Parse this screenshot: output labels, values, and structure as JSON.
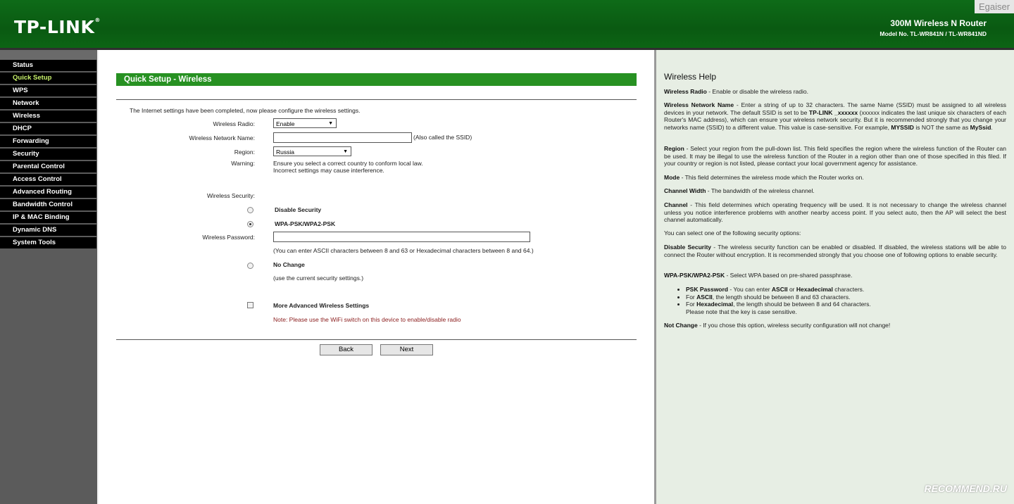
{
  "header": {
    "logo": "TP-LINK",
    "logo_mark": "®",
    "product": "300M Wireless N Router",
    "model": "Model No. TL-WR841N / TL-WR841ND",
    "watermark_top": "Egaiser"
  },
  "sidebar": {
    "items": [
      {
        "label": "Status"
      },
      {
        "label": "Quick Setup"
      },
      {
        "label": "WPS"
      },
      {
        "label": "Network"
      },
      {
        "label": "Wireless"
      },
      {
        "label": "DHCP"
      },
      {
        "label": "Forwarding"
      },
      {
        "label": "Security"
      },
      {
        "label": "Parental Control"
      },
      {
        "label": "Access Control"
      },
      {
        "label": "Advanced Routing"
      },
      {
        "label": "Bandwidth Control"
      },
      {
        "label": "IP & MAC Binding"
      },
      {
        "label": "Dynamic DNS"
      },
      {
        "label": "System Tools"
      }
    ],
    "active": "Quick Setup"
  },
  "main": {
    "title": "Quick Setup - Wireless",
    "intro": "The Internet settings have been completed, now please configure the wireless settings.",
    "radio_label": "Wireless Radio:",
    "radio_value": "Enable",
    "ssid_label": "Wireless Network Name:",
    "ssid_value": "",
    "ssid_hint": "(Also called the SSID)",
    "region_label": "Region:",
    "region_value": "Russia",
    "warning_label": "Warning:",
    "warning_line1": "Ensure you select a correct country to conform local law.",
    "warning_line2": "Incorrect settings may cause interference.",
    "security_label": "Wireless Security:",
    "opt_disable": "Disable Security",
    "opt_wpa": "WPA-PSK/WPA2-PSK",
    "password_label": "Wireless Password:",
    "password_value": "",
    "password_hint": "(You can enter ASCII characters between 8 and 63 or Hexadecimal characters between 8 and 64.)",
    "opt_nochange": "No Change",
    "nochange_hint": "(use the current security settings.)",
    "advanced_label": "More Advanced Wireless Settings",
    "note": "Note: Please use the WiFi switch on this device to enable/disable radio",
    "back_label": "Back",
    "next_label": "Next"
  },
  "help": {
    "title": "Wireless Help",
    "radio_term": "Wireless Radio",
    "radio_text": " - Enable or disable the wireless radio.",
    "name_term": "Wireless Network Name",
    "name_text1": " - Enter a string of up to 32 characters. The same Name (SSID) must be assigned to all wireless devices in your network. The default SSID is set to be ",
    "name_default": "TP-LINK _xxxxxx",
    "name_text2": " (xxxxxx indicates the last unique six characters of each Router's MAC address), which can ensure your wireless network security. But it is recommended strongly that you change your networks name (SSID) to a different value. This value is case-sensitive. For example, ",
    "name_ex1": "MYSSID",
    "name_text3": " is NOT the same as ",
    "name_ex2": "MySsid",
    "name_text4": ".",
    "region_term": "Region",
    "region_text": " - Select your region from the pull-down list. This field specifies the region where the wireless function of the Router can be used. It may be illegal to use the wireless function of the Router in a region other than one of those specified in this filed. If your country or region is not listed, please contact your local government agency for assistance.",
    "mode_term": "Mode",
    "mode_text": " - This field determines the wireless mode which the Router works on.",
    "width_term": "Channel Width",
    "width_text": " - The bandwidth of the wireless channel.",
    "channel_term": "Channel",
    "channel_text": " - This field determines which operating frequency will be used. It is not necessary to change the wireless channel unless you notice interference problems with another nearby access point. If you select auto, then the AP will select the best channel automatically.",
    "options_intro": "You can select one of the following security options:",
    "disable_term": "Disable Security",
    "disable_text": " - The wireless security function can be enabled or disabled. If disabled, the wireless stations will be able to connect the Router without encryption. It is recommended strongly that you choose one of following options to enable security.",
    "wpa_term": "WPA-PSK/WPA2-PSK",
    "wpa_text": " - Select WPA based on pre-shared passphrase.",
    "psk_term": "PSK Password",
    "psk_text1": " - You can enter ",
    "psk_ascii": "ASCII",
    "psk_or": " or ",
    "psk_hex": "Hexadecimal",
    "psk_text2": " characters.",
    "ascii_pre": "For ",
    "ascii_term": "ASCII",
    "ascii_text": ", the length should be between 8 and 63 characters.",
    "hex_pre": "For ",
    "hex_term": "Hexadecimal",
    "hex_text": ", the length should be between 8 and 64 characters.",
    "case_note": "Please note that the key is case sensitive.",
    "notchange_term": "Not Change",
    "notchange_text": " - If you chose this option, wireless security configuration will not change!"
  },
  "watermark_bottom": "RECOMMEND.RU"
}
